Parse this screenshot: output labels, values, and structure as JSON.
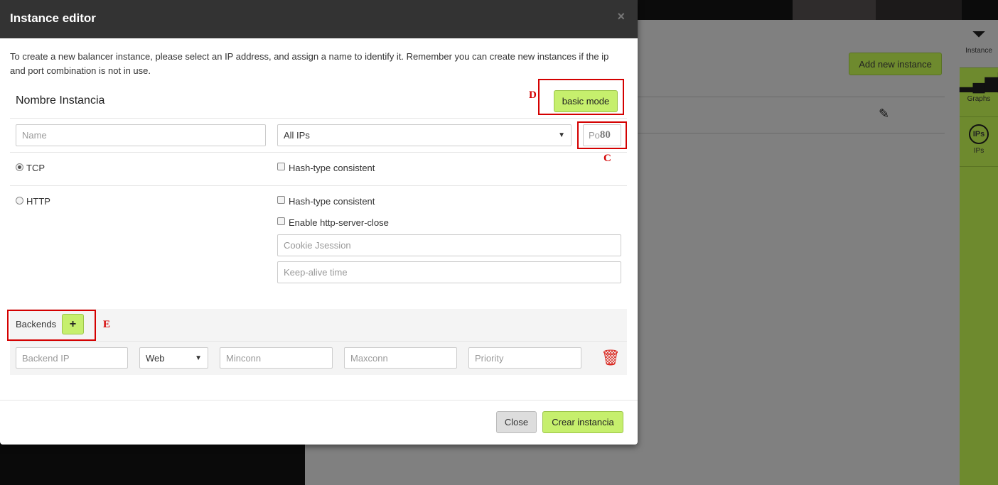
{
  "background": {
    "add_instance_label": "Add new instance",
    "edit_icon": "pencil-icon",
    "sidebar": [
      {
        "label": "Instance",
        "icon": "filter-icon"
      },
      {
        "label": "Graphs",
        "icon": "bar-signal-icon"
      },
      {
        "label": "IPs",
        "icon": "ips-circle-icon",
        "icon_text": "IPs"
      }
    ]
  },
  "modal": {
    "title": "Instance editor",
    "close_glyph": "×",
    "intro": "To create a new balancer instance, please select an IP address, and assign a name to identify it. Remember you can create new instances if the ip and port combination is not in use.",
    "section_title": "Nombre Instancia",
    "basic_mode_label": "basic mode",
    "name_placeholder": "Name",
    "ip_select_value": "All IPs",
    "port_placeholder": "Po",
    "port_overlay": "80",
    "protocols": [
      {
        "label": "TCP",
        "selected": true
      },
      {
        "label": "HTTP",
        "selected": false
      }
    ],
    "tcp_options": [
      "Hash-type consistent"
    ],
    "http_options": [
      "Hash-type consistent",
      "Enable http-server-close"
    ],
    "cookie_placeholder": "Cookie Jsession",
    "keepalive_placeholder": "Keep-alive time",
    "backends_label": "Backends",
    "add_backend_glyph": "+",
    "backend_row": {
      "ip_placeholder": "Backend IP",
      "type_value": "Web",
      "minconn_placeholder": "Minconn",
      "maxconn_placeholder": "Maxconn",
      "priority_placeholder": "Priority"
    },
    "close_label": "Close",
    "create_label": "Crear instancia"
  },
  "annotations": {
    "D": "D",
    "C": "C",
    "E": "E"
  },
  "colors": {
    "accent_green": "#c6ef6d",
    "annotation_red": "#d40000",
    "header_dark": "#333333"
  }
}
